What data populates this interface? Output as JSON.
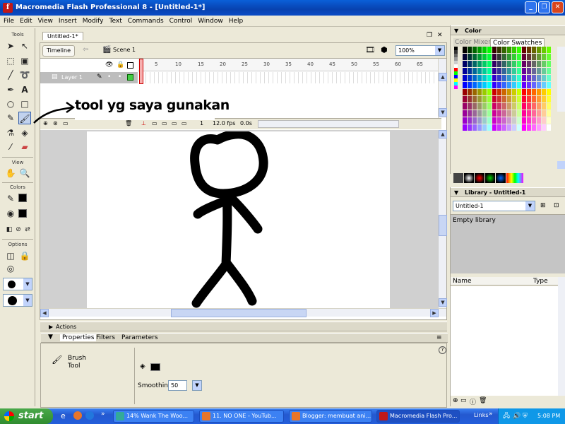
{
  "window": {
    "title": "Macromedia Flash Professional 8 - [Untitled-1*]"
  },
  "menu": [
    "File",
    "Edit",
    "View",
    "Insert",
    "Modify",
    "Text",
    "Commands",
    "Control",
    "Window",
    "Help"
  ],
  "toolbox": {
    "tools_label": "Tools",
    "view_label": "View",
    "colors_label": "Colors",
    "options_label": "Options"
  },
  "document": {
    "tab": "Untitled-1*",
    "timeline_button": "Timeline",
    "scene": "Scene 1",
    "zoom": "100%",
    "layer": "Layer 1",
    "frame_numbers": [
      "1",
      "5",
      "10",
      "15",
      "20",
      "25",
      "30",
      "35",
      "40",
      "45",
      "50",
      "55",
      "60",
      "65"
    ],
    "fps": "12.0 fps",
    "time": "0.0s",
    "frame": "1"
  },
  "annotation": "tool yg saya gunakan",
  "panels": {
    "actions": "Actions",
    "tabs": [
      "Properties",
      "Filters",
      "Parameters"
    ],
    "tool_name": "Brush",
    "tool_sub": "Tool",
    "smoothing_label": "Smoothing",
    "smoothing_value": "50"
  },
  "color_panel": {
    "title": "Color",
    "tabs": [
      "Color Mixer",
      "Color Swatches"
    ]
  },
  "library": {
    "title": "Library - Untitled-1",
    "selected": "Untitled-1",
    "status": "Empty library",
    "col_name": "Name",
    "col_type": "Type"
  },
  "taskbar": {
    "start": "start",
    "items": [
      "14% Wank The Woo...",
      "11. NO ONE - YouTub...",
      "Blogger: membuat ani...",
      "Macromedia Flash Pro..."
    ],
    "links": "Links",
    "clock": "5:08 PM"
  }
}
